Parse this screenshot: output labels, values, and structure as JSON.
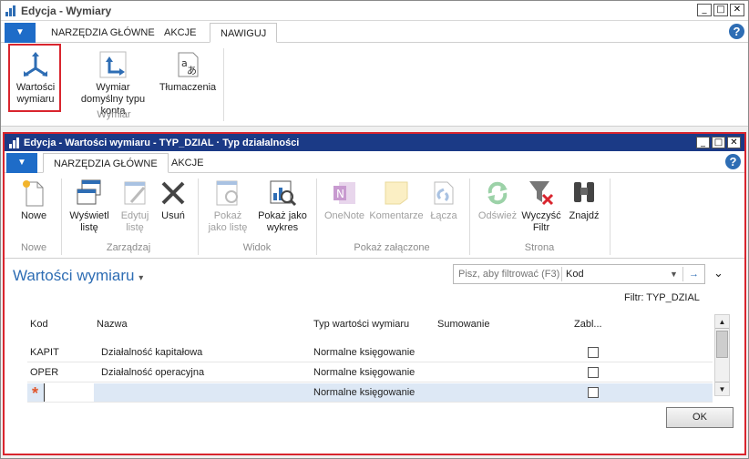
{
  "outer": {
    "title": "Edycja - Wymiary",
    "tabs": [
      "NARZĘDZIA GŁÓWNE",
      "AKCJE",
      "NAWIGUJ"
    ],
    "active_tab": "NAWIGUJ",
    "ribbon": {
      "buttons": [
        {
          "label1": "Wartości",
          "label2": "wymiaru"
        },
        {
          "label1": "Wymiar",
          "label2": "domyślny typu konta"
        },
        {
          "label1": "Tłumaczenia",
          "label2": ""
        }
      ],
      "group": "Wymiar"
    }
  },
  "inner": {
    "title": "Edycja - Wartości wymiaru - TYP_DZIAL · Typ działalności",
    "tabs": [
      "NARZĘDZIA GŁÓWNE",
      "AKCJE"
    ],
    "ribbon": {
      "new": {
        "label1": "Nowe",
        "label2": ""
      },
      "show_list": {
        "label1": "Wyświetl",
        "label2": "listę"
      },
      "edit_list": {
        "label1": "Edytuj",
        "label2": "listę"
      },
      "delete": {
        "label1": "Usuń",
        "label2": ""
      },
      "show_as_list": {
        "label1": "Pokaż",
        "label2": "jako listę"
      },
      "show_as_chart": {
        "label1": "Pokaż jako",
        "label2": "wykres"
      },
      "onenote": {
        "label1": "OneNote",
        "label2": ""
      },
      "comments": {
        "label1": "Komentarze",
        "label2": ""
      },
      "links": {
        "label1": "Łącza",
        "label2": ""
      },
      "refresh": {
        "label1": "Odśwież",
        "label2": ""
      },
      "clear_filter": {
        "label1": "Wyczyść",
        "label2": "Filtr"
      },
      "find": {
        "label1": "Znajdź",
        "label2": ""
      },
      "groups": {
        "new": "Nowe",
        "manage": "Zarządzaj",
        "view": "Widok",
        "attached": "Pokaż załączone",
        "page": "Strona"
      }
    },
    "page_title": "Wartości wymiaru",
    "search": {
      "placeholder": "Pisz, aby filtrować (F3)",
      "field": "Kod"
    },
    "filter_text": "Filtr: TYP_DZIAL",
    "columns": [
      "Kod",
      "Nazwa",
      "Typ wartości wymiaru",
      "Sumowanie",
      "Zabl..."
    ],
    "rows": [
      {
        "code": "KAPIT",
        "name": "Działalność kapitałowa",
        "type": "Normalne księgowanie",
        "total": "",
        "blocked": false
      },
      {
        "code": "OPER",
        "name": "Działalność operacyjna",
        "type": "Normalne księgowanie",
        "total": "",
        "blocked": false
      },
      {
        "code": "",
        "name": "",
        "type": "Normalne księgowanie",
        "total": "",
        "blocked": false
      }
    ],
    "new_row_marker": "*",
    "ok": "OK"
  },
  "colors": {
    "accent": "#2e6db4",
    "highlight": "#d9252e",
    "inner_title": "#1b3a86",
    "selected_row": "#dde8f5"
  },
  "icons": [
    "app-icon",
    "dimension-arrows-icon",
    "translate-icon",
    "new-page-icon",
    "list-icon",
    "edit-list-icon",
    "delete-x-icon",
    "onenote-icon",
    "note-icon",
    "link-icon",
    "refresh-icon",
    "clear-filter-icon",
    "binoculars-icon",
    "help-icon"
  ]
}
